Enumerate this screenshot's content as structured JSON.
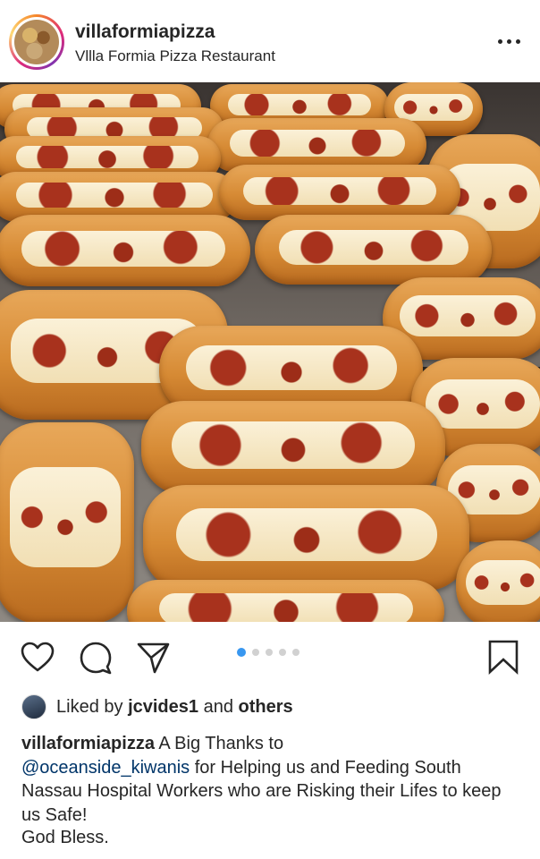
{
  "post": {
    "username": "villaformiapizza",
    "location": "Vllla Formia Pizza Restaurant",
    "more_icon": "more-horizontal-icon",
    "image_alt_subject": "meatball parm hero sandwiches on baking tray"
  },
  "actions": {
    "like_icon": "heart-icon",
    "comment_icon": "comment-icon",
    "share_icon": "paper-plane-icon",
    "save_icon": "bookmark-icon",
    "carousel_total": 5,
    "carousel_active": 1,
    "accent_color": "#3897f0"
  },
  "likes": {
    "prefix": "Liked by ",
    "user": "jcvides1",
    "middle": " and ",
    "others": "others"
  },
  "caption": {
    "username": "villaformiapizza",
    "text_before_mention": " A Big Thanks to ",
    "mention": "@oceanside_kiwanis",
    "text_after_mention": "  for Helping us and Feeding South Nassau Hospital Workers who are Risking their Lifes to keep us Safe!",
    "signoff": "God Bless."
  }
}
